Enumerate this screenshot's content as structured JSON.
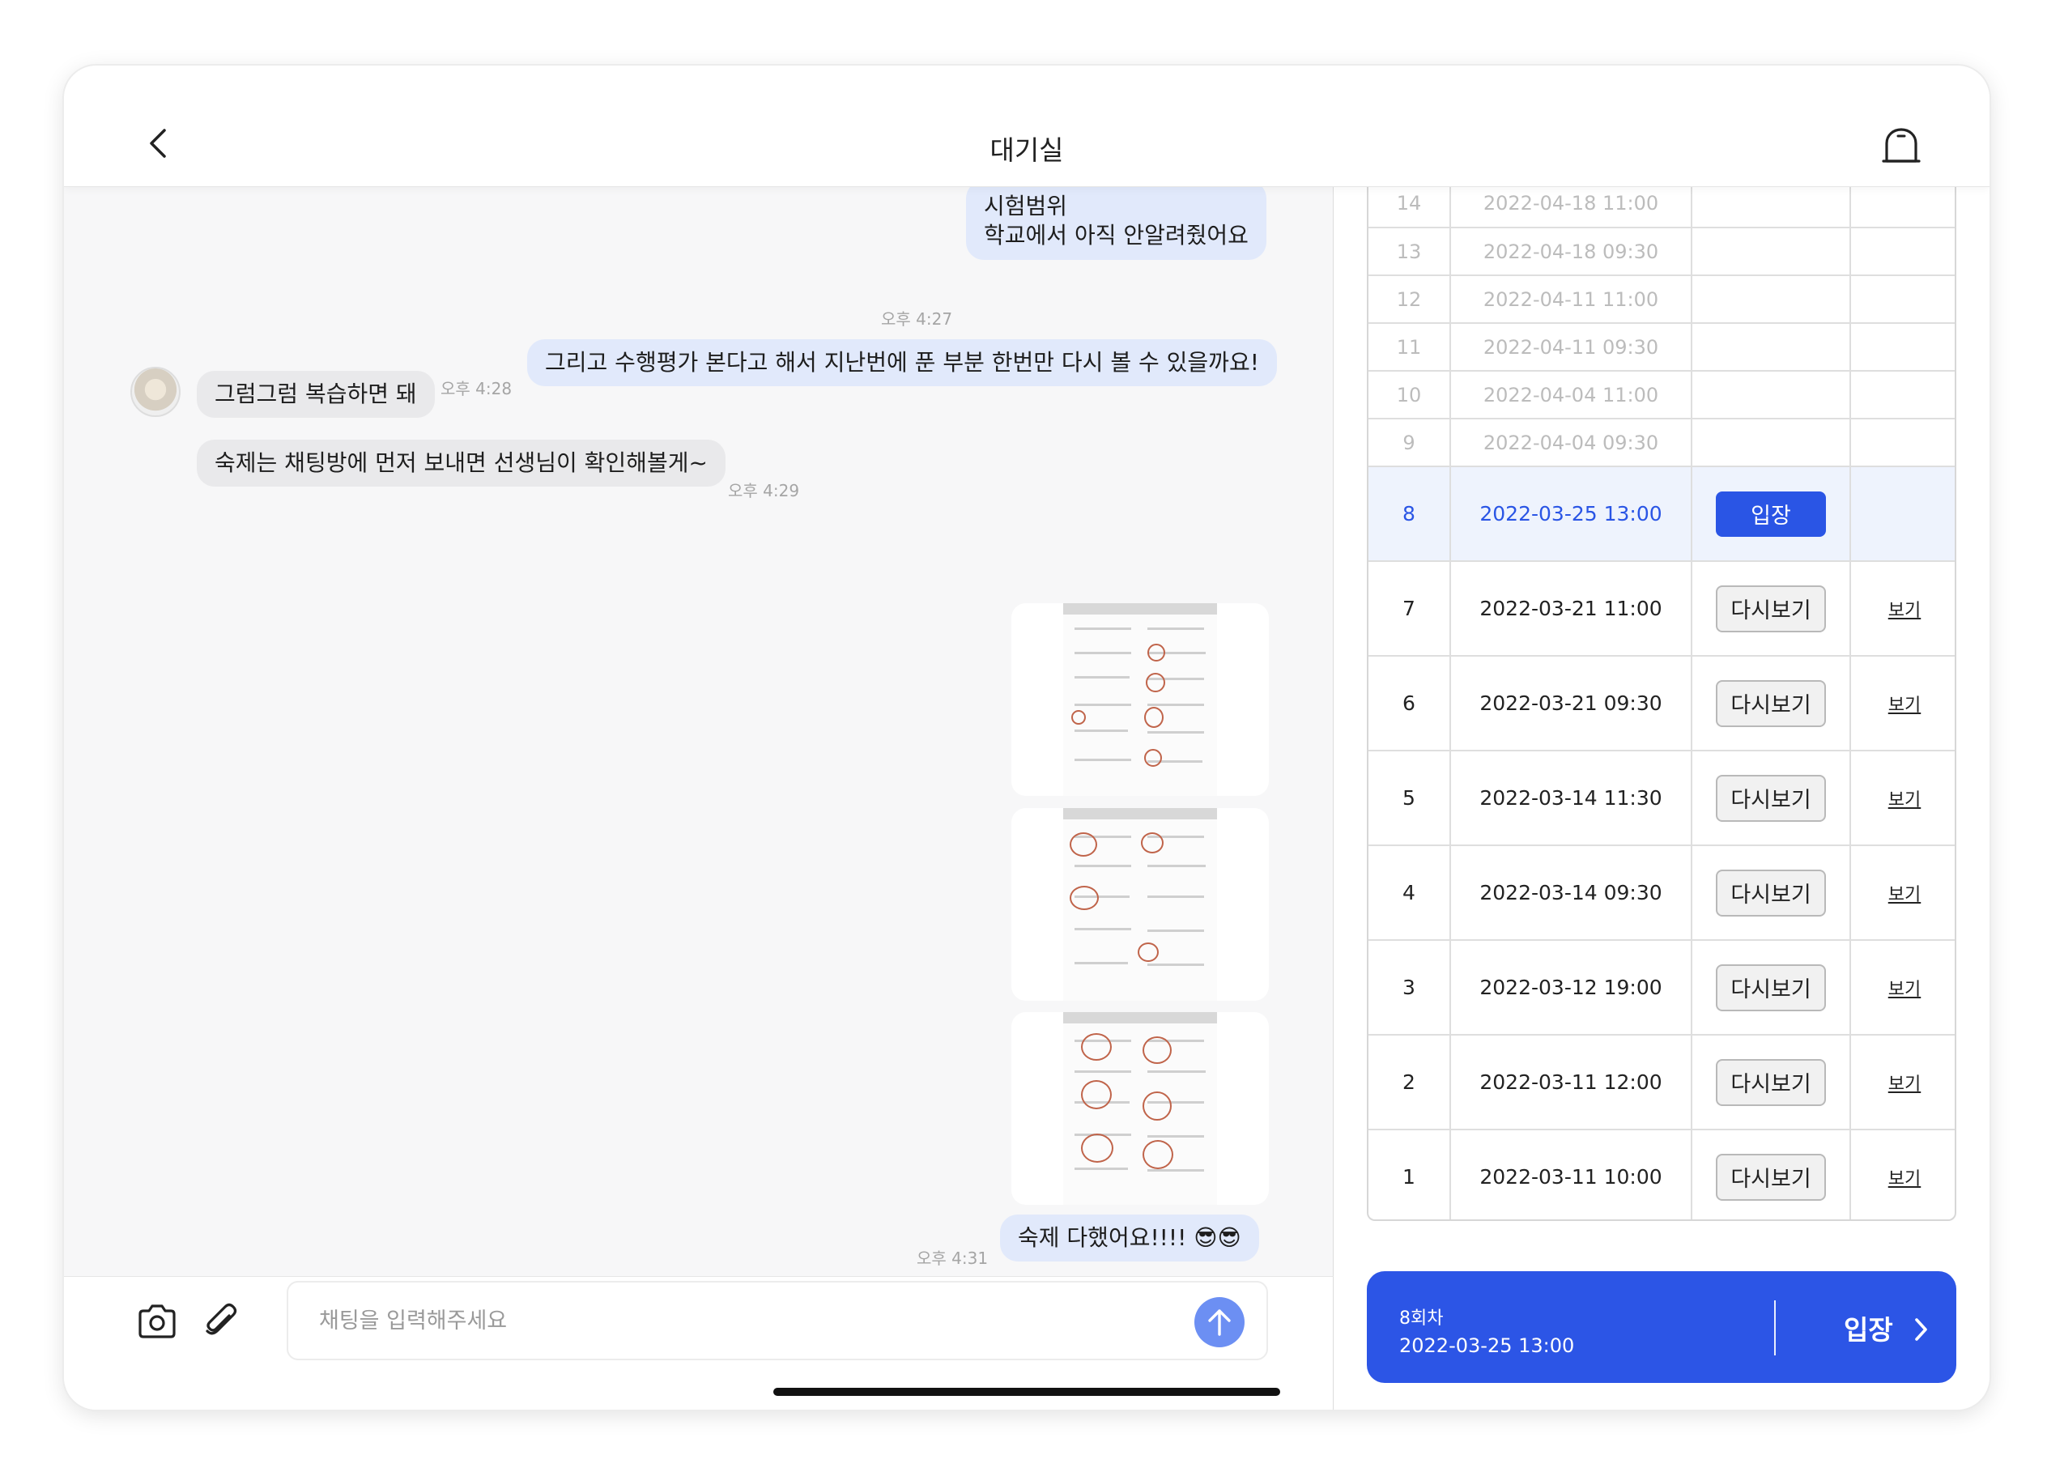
{
  "header": {
    "title": "대기실"
  },
  "messages": {
    "m1": {
      "text_line1": "시험범위",
      "text_line2": "학교에서 아직 안알려줬어요",
      "time": "오후 4:27"
    },
    "m2": {
      "text": "그리고 수행평가 본다고 해서 지난번에 푼 부분 한번만 다시 볼 수 있을까요!",
      "time": "오후 4:28"
    },
    "m3": {
      "text": "그럼그럼 복습하면 돼"
    },
    "m4": {
      "text": "숙제는 채팅방에 먼저 보내면 선생님이 확인해볼게~",
      "time": "오후 4:29"
    },
    "m5": {
      "text": "숙제 다했어요!!!! 😎😎",
      "time": "오후 4:31"
    }
  },
  "composer": {
    "placeholder": "채팅을 입력해주세요"
  },
  "sessions": {
    "enter_label": "입장",
    "replay_label": "다시보기",
    "view_label": "보기",
    "rows": [
      {
        "no": "14",
        "datetime": "2022-04-18 11:00",
        "state": "upcoming"
      },
      {
        "no": "13",
        "datetime": "2022-04-18 09:30",
        "state": "upcoming"
      },
      {
        "no": "12",
        "datetime": "2022-04-11 11:00",
        "state": "upcoming"
      },
      {
        "no": "11",
        "datetime": "2022-04-11 09:30",
        "state": "upcoming"
      },
      {
        "no": "10",
        "datetime": "2022-04-04 11:00",
        "state": "upcoming"
      },
      {
        "no": "9",
        "datetime": "2022-04-04 09:30",
        "state": "upcoming"
      },
      {
        "no": "8",
        "datetime": "2022-03-25 13:00",
        "state": "current"
      },
      {
        "no": "7",
        "datetime": "2022-03-21 11:00",
        "state": "past"
      },
      {
        "no": "6",
        "datetime": "2022-03-21 09:30",
        "state": "past"
      },
      {
        "no": "5",
        "datetime": "2022-03-14 11:30",
        "state": "past"
      },
      {
        "no": "4",
        "datetime": "2022-03-14 09:30",
        "state": "past"
      },
      {
        "no": "3",
        "datetime": "2022-03-12 19:00",
        "state": "past"
      },
      {
        "no": "2",
        "datetime": "2022-03-11 12:00",
        "state": "past"
      },
      {
        "no": "1",
        "datetime": "2022-03-11 10:00",
        "state": "past"
      }
    ]
  },
  "cta": {
    "round": "8회차",
    "datetime": "2022-03-25 13:00",
    "label": "입장"
  },
  "icons": [
    "back-arrow-icon",
    "bell-icon",
    "camera-icon",
    "paperclip-icon",
    "send-arrow-icon",
    "chevron-right-icon",
    "battery-icon"
  ],
  "colors": {
    "accent": "#2a55e5",
    "my_bubble": "#e1e9fb",
    "their_bubble": "#e9e9eb"
  }
}
